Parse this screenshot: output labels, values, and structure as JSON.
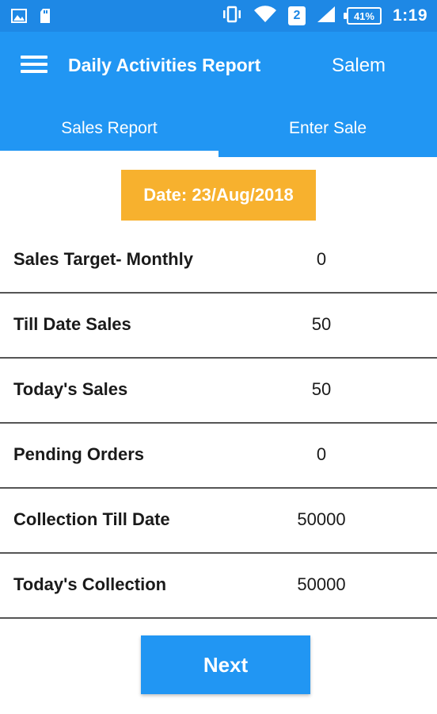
{
  "status_bar": {
    "icons_left": [
      "image-icon",
      "sd-card-icon"
    ],
    "icons_right": [
      "vibrate-icon",
      "wifi-icon",
      "signal-icon"
    ],
    "sim_slot": "2",
    "battery": "41%",
    "time": "1:19"
  },
  "app_bar": {
    "title": "Daily Activities Report",
    "location": "Salem"
  },
  "tabs": [
    {
      "label": "Sales Report",
      "active": true
    },
    {
      "label": "Enter Sale",
      "active": false
    }
  ],
  "date_label": "Date: 23/Aug/2018",
  "rows": [
    {
      "label": "Sales Target- Monthly",
      "value": "0"
    },
    {
      "label": "Till Date Sales",
      "value": "50"
    },
    {
      "label": "Today's Sales",
      "value": "50"
    },
    {
      "label": "Pending Orders",
      "value": "0"
    },
    {
      "label": "Collection Till Date",
      "value": "50000"
    },
    {
      "label": "Today's Collection",
      "value": "50000"
    }
  ],
  "next_button": "Next",
  "colors": {
    "status_bar": "#1e88e5",
    "primary": "#2196f3",
    "date_badge": "#f7b12e",
    "divider": "#555555"
  }
}
